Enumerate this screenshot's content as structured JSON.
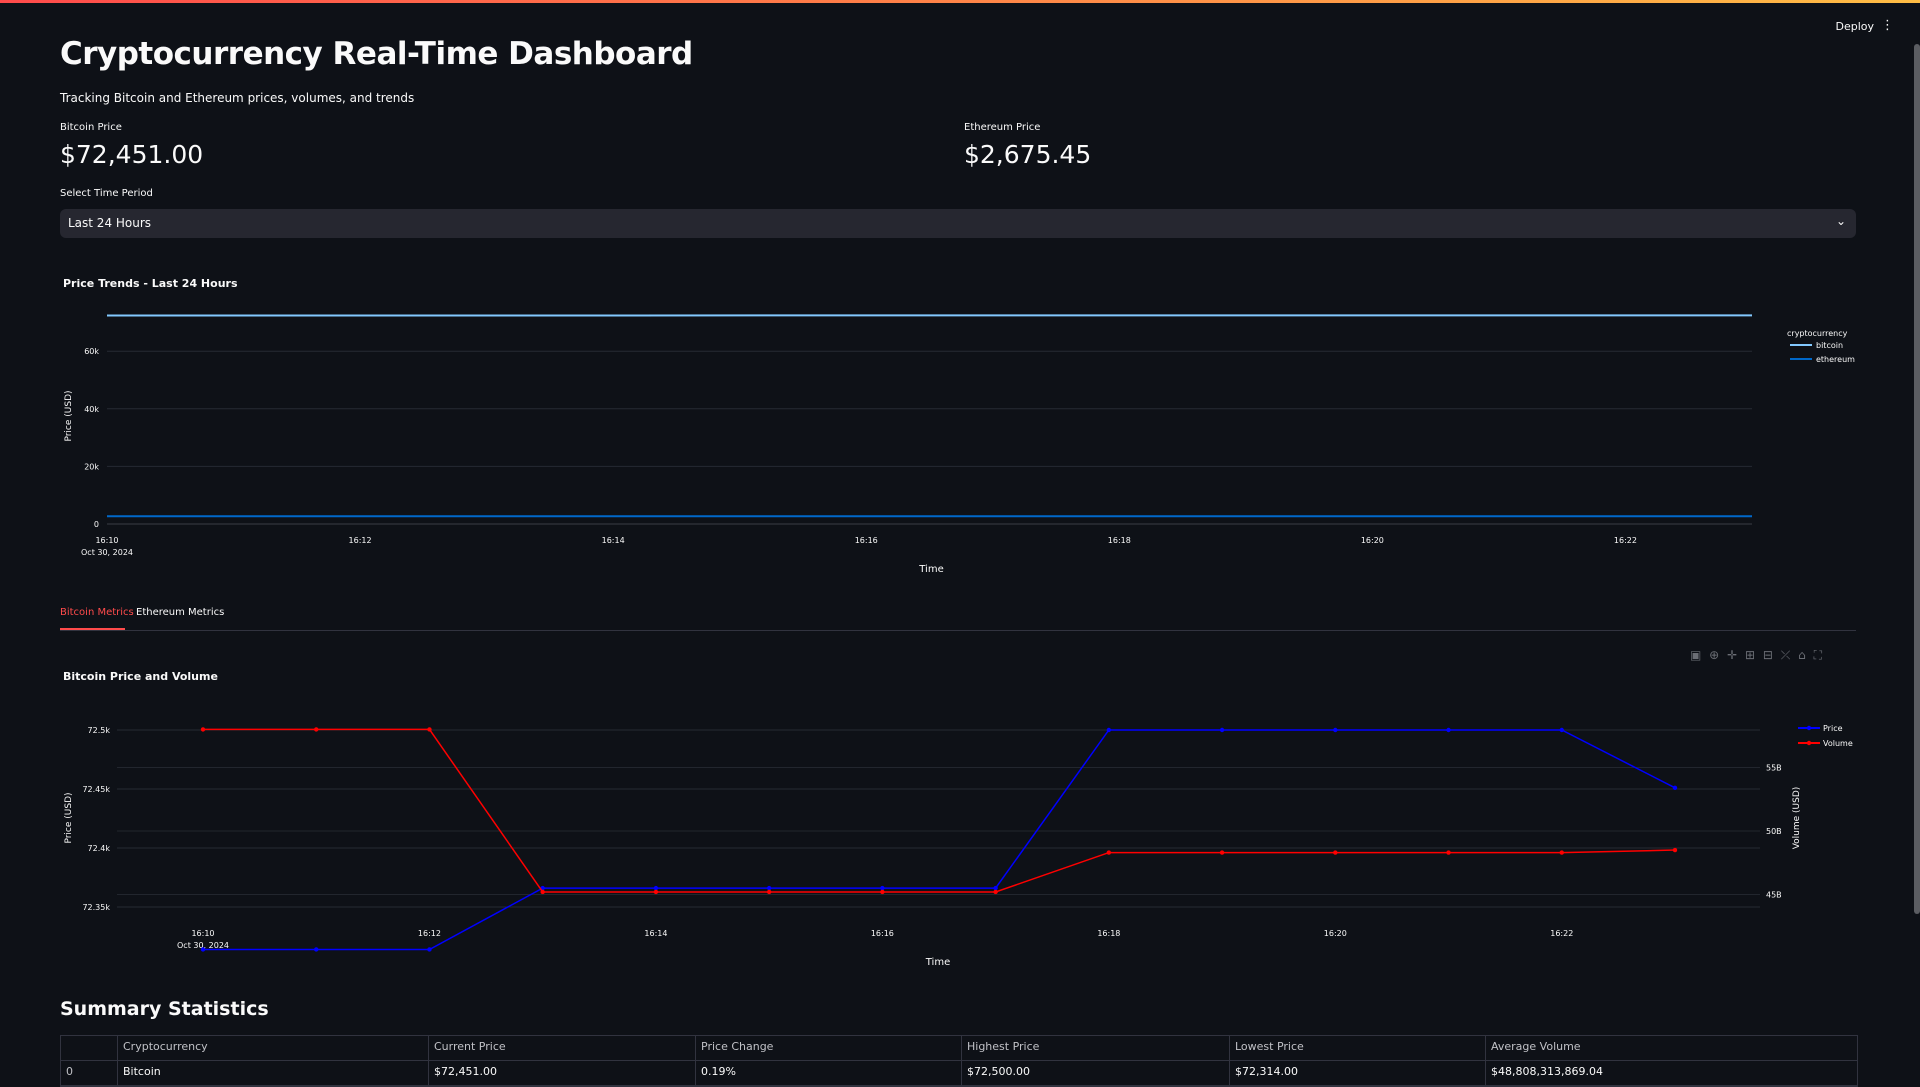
{
  "header": {
    "deploy_label": "Deploy",
    "menu_icon": "kebab-menu-icon"
  },
  "page": {
    "title": "Cryptocurrency Real-Time Dashboard",
    "subtitle": "Tracking Bitcoin and Ethereum prices, volumes, and trends"
  },
  "metrics": [
    {
      "label": "Bitcoin Price",
      "value": "$72,451.00"
    },
    {
      "label": "Ethereum Price",
      "value": "$2,675.45"
    }
  ],
  "time_period": {
    "label": "Select Time Period",
    "selected": "Last 24 Hours"
  },
  "tabs": [
    {
      "label": "Bitcoin Metrics",
      "active": true
    },
    {
      "label": "Ethereum Metrics",
      "active": false
    }
  ],
  "chart_data": [
    {
      "type": "line",
      "title": "Price Trends - Last 24 Hours",
      "xlabel": "Time",
      "ylabel": "Price (USD)",
      "x_ticks": [
        "16:10",
        "16:12",
        "16:14",
        "16:16",
        "16:18",
        "16:20",
        "16:22"
      ],
      "x_date_label": "Oct 30, 2024",
      "y_ticks": [
        "0",
        "20k",
        "40k",
        "60k"
      ],
      "ylim": [
        0,
        75000
      ],
      "legend_title": "cryptocurrency",
      "legend_position": "right",
      "series": [
        {
          "name": "bitcoin",
          "color": "#83c9ff",
          "points": [
            [
              "16:10",
              72400
            ],
            [
              "16:23",
              72451
            ]
          ]
        },
        {
          "name": "ethereum",
          "color": "#0068c9",
          "points": [
            [
              "16:10",
              2675
            ],
            [
              "16:23",
              2675.45
            ]
          ]
        }
      ]
    },
    {
      "type": "line",
      "title": "Bitcoin Price and Volume",
      "xlabel": "Time",
      "ylabel": "Price (USD)",
      "y2label": "Volume (USD)",
      "x_ticks": [
        "16:10",
        "16:12",
        "16:14",
        "16:16",
        "16:18",
        "16:20",
        "16:22"
      ],
      "x_date_label": "Oct 30, 2024",
      "y_ticks": [
        "72.35k",
        "72.4k",
        "72.45k",
        "72.5k"
      ],
      "y2_ticks": [
        "45B",
        "50B",
        "55B"
      ],
      "legend_position": "right",
      "x": [
        "16:10",
        "16:11",
        "16:12",
        "16:13",
        "16:14",
        "16:15",
        "16:16",
        "16:17",
        "16:18",
        "16:19",
        "16:20",
        "16:21",
        "16:22",
        "16:23"
      ],
      "series": [
        {
          "name": "Price",
          "color": "#0000ff",
          "axis": "left",
          "values": [
            72314,
            72314,
            72314,
            72366,
            72366,
            72366,
            72366,
            72366,
            72500,
            72500,
            72500,
            72500,
            72500,
            72451
          ]
        },
        {
          "name": "Volume",
          "color": "#ff0000",
          "axis": "right",
          "values": [
            58.0,
            58.0,
            58.0,
            45.2,
            45.2,
            45.2,
            45.2,
            45.2,
            48.3,
            48.3,
            48.3,
            48.3,
            48.3,
            48.5
          ]
        }
      ]
    }
  ],
  "modebar_icons": [
    "camera-icon",
    "zoom-icon",
    "pan-icon",
    "zoom-in-icon",
    "zoom-out-icon",
    "autoscale-icon",
    "reset-axes-icon",
    "fullscreen-icon"
  ],
  "summary": {
    "title": "Summary Statistics",
    "columns": [
      "",
      "Cryptocurrency",
      "Current Price",
      "Price Change",
      "Highest Price",
      "Lowest Price",
      "Average Volume"
    ],
    "rows": [
      [
        "0",
        "Bitcoin",
        "$72,451.00",
        "0.19%",
        "$72,500.00",
        "$72,314.00",
        "$48,808,313,869.04"
      ]
    ]
  }
}
